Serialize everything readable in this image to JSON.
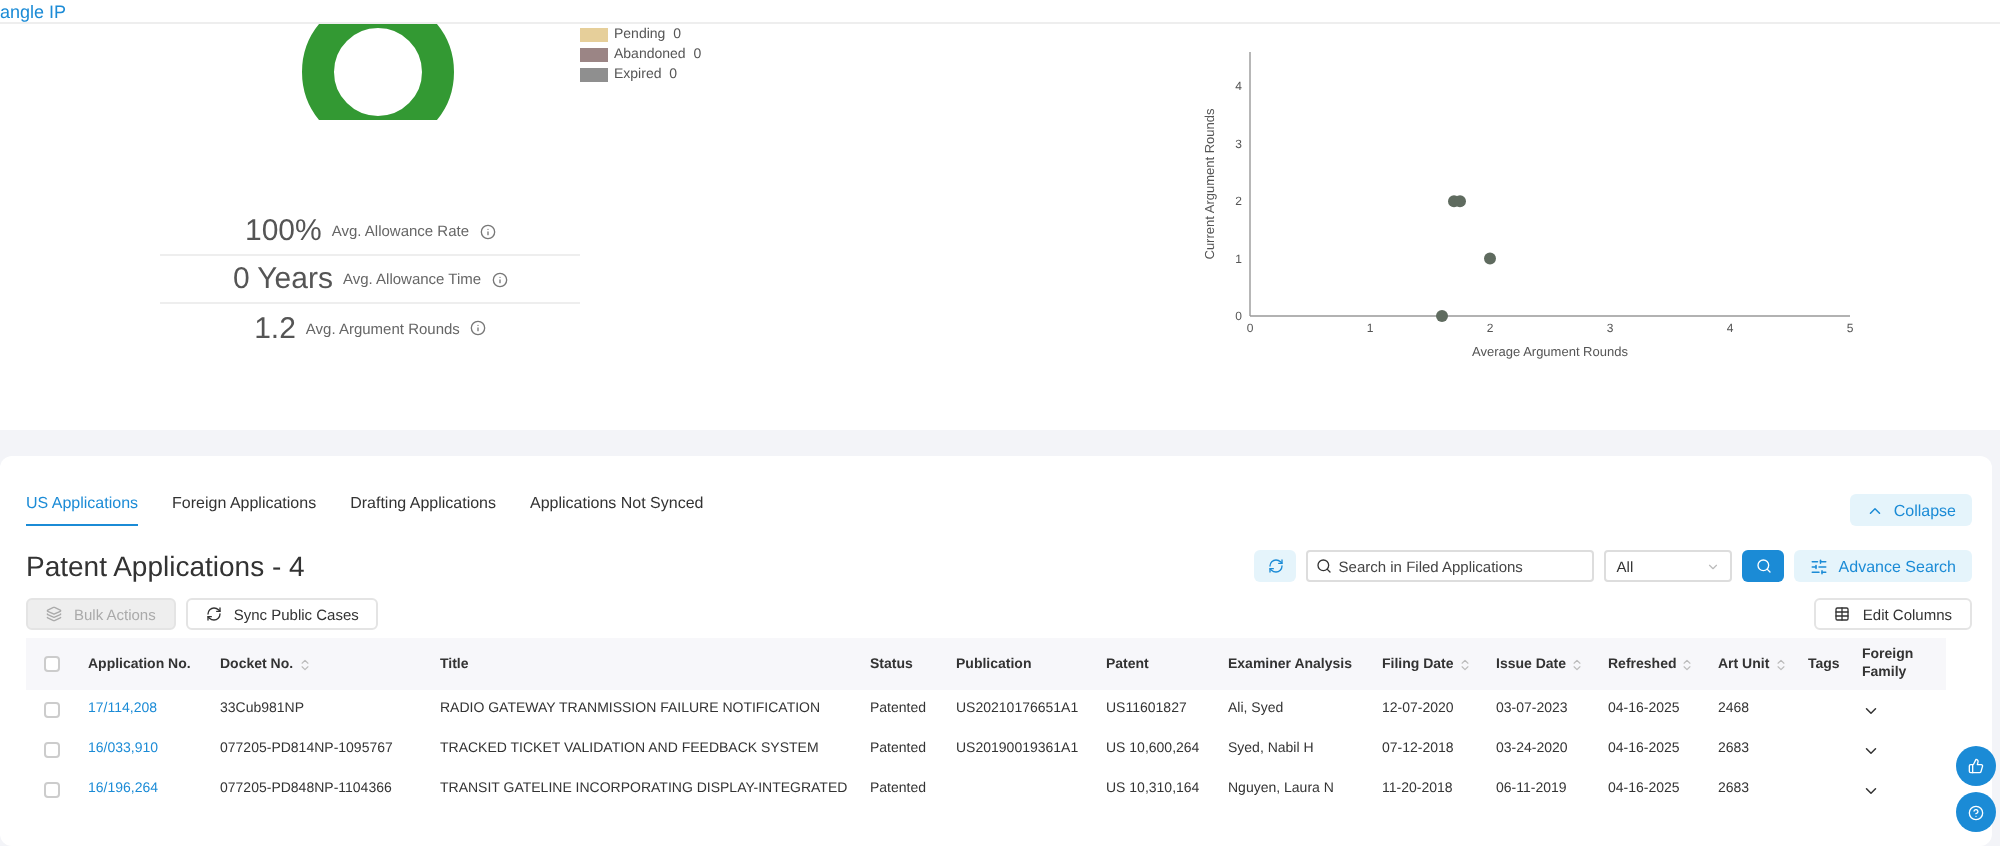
{
  "header": {
    "brand": "angle IP"
  },
  "summary": {
    "legend": [
      {
        "label": "Pending",
        "count": "0",
        "color": "#e6cf9a"
      },
      {
        "label": "Abandoned",
        "count": "0",
        "color": "#9b8585"
      },
      {
        "label": "Expired",
        "count": "0",
        "color": "#8f8f8f"
      }
    ],
    "stats": [
      {
        "value": "100%",
        "label": "Avg. Allowance Rate"
      },
      {
        "value": "0 Years",
        "label": "Avg. Allowance Time"
      },
      {
        "value": "1.2",
        "label": "Avg. Argument Rounds"
      }
    ],
    "chart_data": {
      "type": "scatter",
      "xlabel": "Average Argument Rounds",
      "ylabel": "Current Argument Rounds",
      "x": [
        1.6,
        1.7,
        1.75,
        2
      ],
      "series": [
        {
          "color": "#5f6b5f",
          "values": [
            0,
            2,
            2,
            1
          ]
        }
      ],
      "xlim": [
        0,
        5
      ],
      "ylim": [
        0,
        4.6
      ],
      "xticks": [
        0,
        1,
        2,
        3,
        4,
        5
      ],
      "yticks": [
        0,
        1,
        2,
        3,
        4
      ]
    }
  },
  "tabs": [
    {
      "label": "US Applications",
      "selected": true
    },
    {
      "label": "Foreign Applications",
      "selected": false
    },
    {
      "label": "Drafting Applications",
      "selected": false
    },
    {
      "label": "Applications Not Synced",
      "selected": false
    }
  ],
  "collapse": "Collapse",
  "heading": "Patent Applications - 4",
  "search": {
    "placeholder": "Search in Filed Applications",
    "filter": "All",
    "advance": "Advance Search"
  },
  "actions": [
    {
      "label": "Bulk Actions",
      "disabled": true
    },
    {
      "label": "Sync Public Cases",
      "disabled": false
    }
  ],
  "edit_columns": "Edit Columns",
  "table": {
    "select_all_checked": false,
    "columns": [
      {
        "label": "Application No.",
        "sortable": false
      },
      {
        "label": "Docket No.",
        "sortable": true
      },
      {
        "label": "Title",
        "sortable": false
      },
      {
        "label": "Status",
        "sortable": false
      },
      {
        "label": "Publication",
        "sortable": false
      },
      {
        "label": "Patent",
        "sortable": false
      },
      {
        "label": "Examiner Analysis",
        "sortable": false
      },
      {
        "label": "Filing Date",
        "sortable": true
      },
      {
        "label": "Issue Date",
        "sortable": true
      },
      {
        "label": "Refreshed",
        "sortable": true
      },
      {
        "label": "Art Unit",
        "sortable": true
      },
      {
        "label": "Tags",
        "sortable": false
      },
      {
        "label": "Foreign Family",
        "sortable": false
      }
    ],
    "rows": [
      {
        "checked": false,
        "cells": [
          "17/114,208",
          "33Cub981NP",
          "RADIO GATEWAY TRANMISSION FAILURE NOTIFICATION",
          "Patented",
          "US20210176651A1",
          "US11601827",
          "Ali, Syed",
          "12-07-2020",
          "03-07-2023",
          "04-16-2025",
          "2468"
        ]
      },
      {
        "checked": false,
        "cells": [
          "16/033,910",
          "077205-PD814NP-1095767",
          "TRACKED TICKET VALIDATION AND FEEDBACK SYSTEM",
          "Patented",
          "US20190019361A1",
          "US 10,600,264",
          "Syed, Nabil H",
          "07-12-2018",
          "03-24-2020",
          "04-16-2025",
          "2683"
        ]
      },
      {
        "checked": false,
        "cells": [
          "16/196,264",
          "077205-PD848NP-1104366",
          "TRANSIT GATELINE INCORPORATING DISPLAY-INTEGRATED",
          "Patented",
          "",
          "US 10,310,164",
          "Nguyen, Laura N",
          "11-20-2018",
          "06-11-2019",
          "04-16-2025",
          "2683"
        ]
      }
    ]
  }
}
